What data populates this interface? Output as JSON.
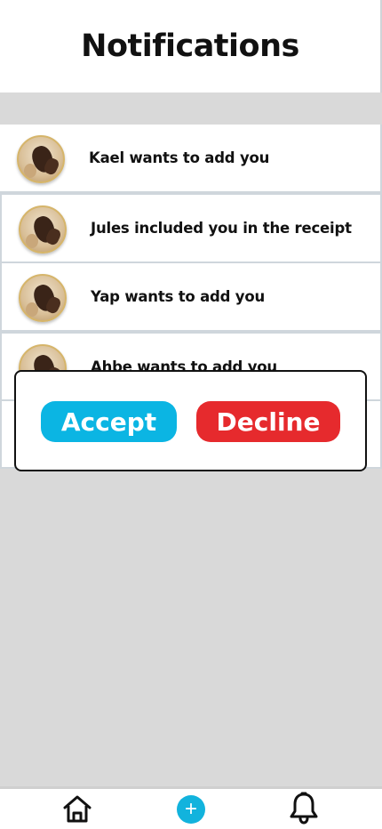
{
  "header": {
    "title": "Notifications"
  },
  "notifications": [
    {
      "text": "Kael wants to add you"
    },
    {
      "text": "Jules included you in the receipt"
    },
    {
      "text": "Yap wants to add you"
    },
    {
      "text": "Ahbe wants to add you"
    }
  ],
  "dialog": {
    "accept_label": "Accept",
    "decline_label": "Decline"
  },
  "nav": {
    "plus_symbol": "+"
  },
  "colors": {
    "accent": "#0bb5e3",
    "danger": "#e62a2d"
  }
}
